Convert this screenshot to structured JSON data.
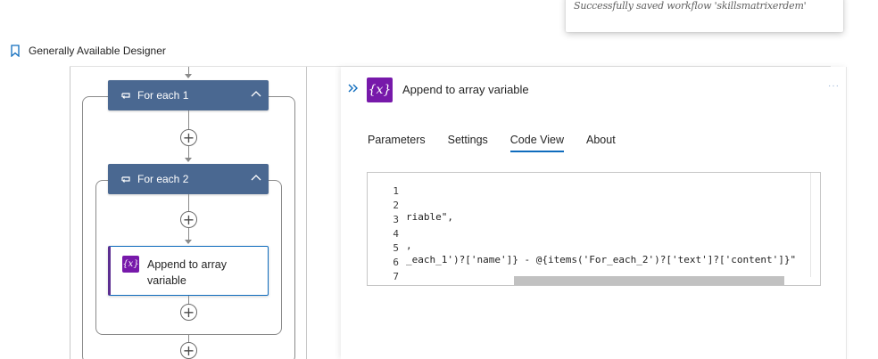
{
  "toast": {
    "message": "Successfully saved workflow 'skillsmatrixerdem'"
  },
  "header": {
    "icon": "bookmark-icon",
    "label": "Generally Available Designer"
  },
  "canvas": {
    "foreach1": {
      "label": "For each 1",
      "icon": "loop-icon"
    },
    "foreach2": {
      "label": "For each 2",
      "icon": "loop-icon"
    },
    "action": {
      "icon_text": "{x}",
      "label": "Append to array variable"
    }
  },
  "panel": {
    "icon_text": "{x}",
    "title": "Append to array variable",
    "more": "···",
    "tabs": [
      {
        "label": "Parameters",
        "active": false
      },
      {
        "label": "Settings",
        "active": false
      },
      {
        "label": "Code View",
        "active": true
      },
      {
        "label": "About",
        "active": false
      }
    ],
    "code": {
      "line_numbers": [
        "1",
        "2",
        "3",
        "4",
        "5",
        "6",
        "7"
      ],
      "lines": [
        "",
        "riable\",",
        "",
        ",",
        "_each_1')?['name']} - @{items('For_each_2')?['text']?['content']}\"",
        "",
        ""
      ]
    }
  },
  "colors": {
    "foreach_card": "#4a6891",
    "variable_icon": "#7719aa",
    "accent": "#0f6cbd"
  }
}
